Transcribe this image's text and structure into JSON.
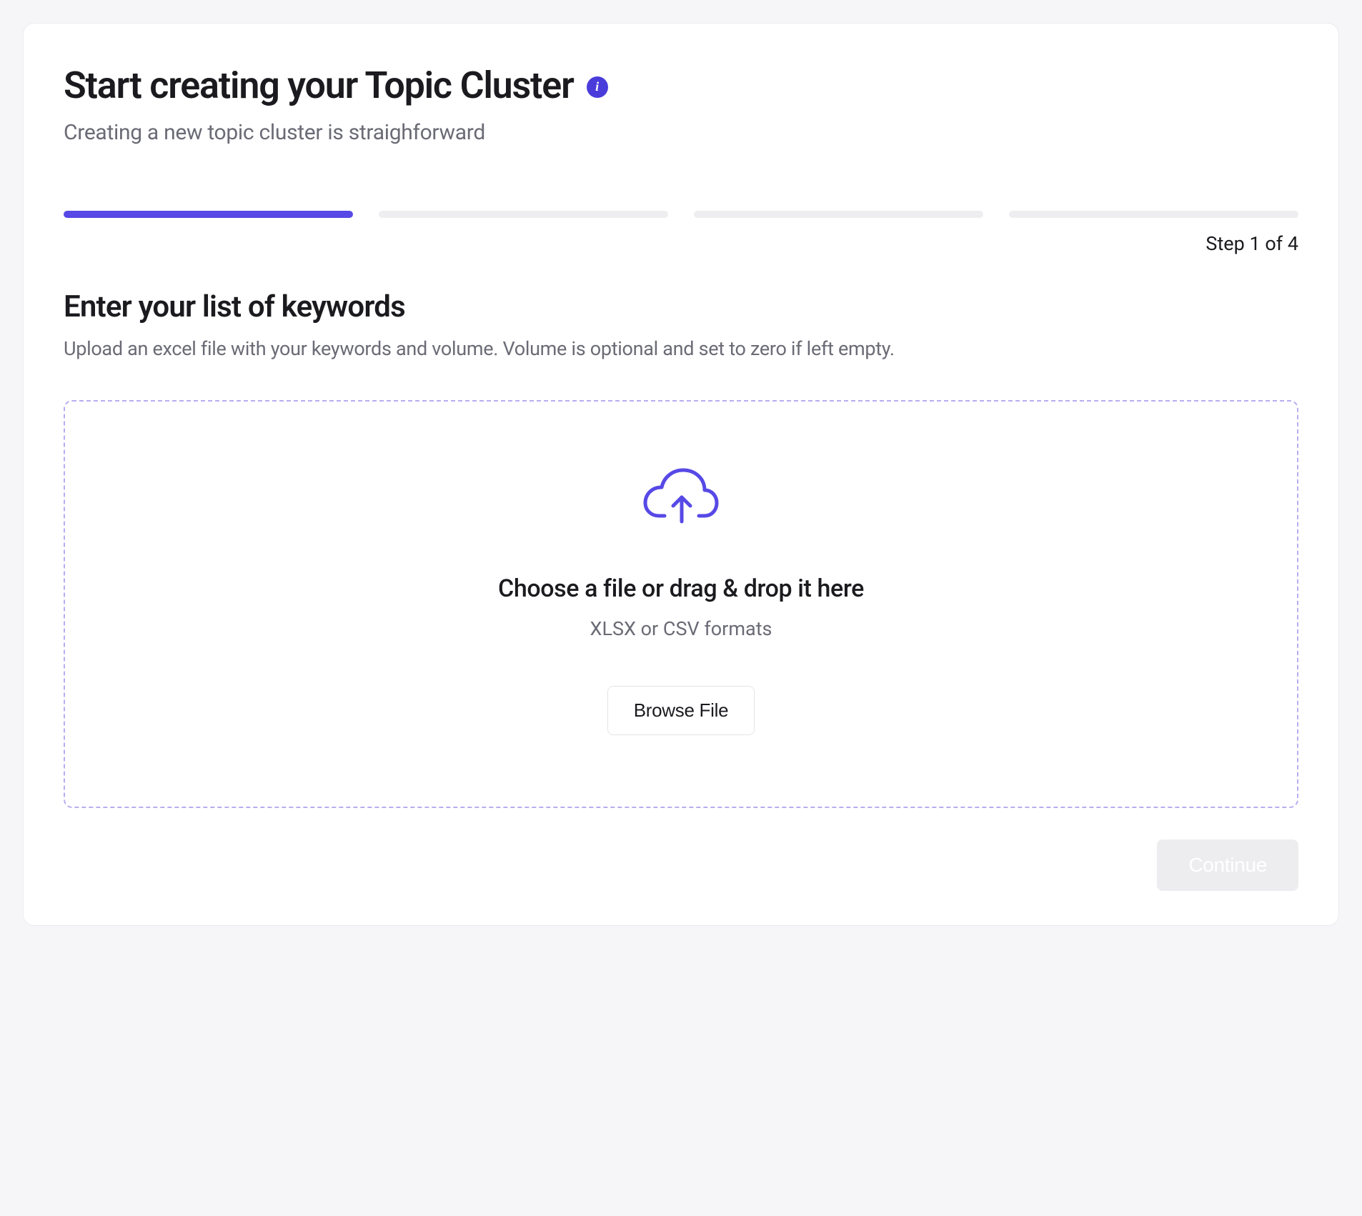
{
  "header": {
    "title": "Start creating your Topic Cluster",
    "subtitle": "Creating a new topic cluster is straighforward"
  },
  "progress": {
    "step_label": "Step 1 of 4",
    "current": 1,
    "total": 4
  },
  "section": {
    "title": "Enter your list of keywords",
    "subtitle": "Upload an excel file with your keywords and volume. Volume is optional and set to zero if left empty."
  },
  "dropzone": {
    "title": "Choose a file or drag & drop it here",
    "formats": "XLSX or CSV formats",
    "browse_label": "Browse File"
  },
  "footer": {
    "continue_label": "Continue"
  },
  "colors": {
    "accent": "#5749e6"
  }
}
